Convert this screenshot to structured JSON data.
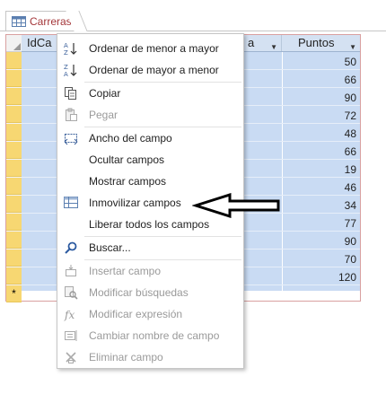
{
  "tab": {
    "label": "Carreras"
  },
  "headers": {
    "col1": "IdCa",
    "col2": "a",
    "col3": "Puntos"
  },
  "values": [
    "50",
    "66",
    "90",
    "72",
    "48",
    "66",
    "19",
    "46",
    "34",
    "77",
    "90",
    "70",
    "120"
  ],
  "new_row_marker": "*",
  "menu": {
    "sort_asc": "Ordenar de menor a mayor",
    "sort_desc": "Ordenar de mayor a menor",
    "copy": "Copiar",
    "paste": "Pegar",
    "field_width": "Ancho del campo",
    "hide_fields": "Ocultar campos",
    "show_fields": "Mostrar campos",
    "freeze_fields": "Inmovilizar campos",
    "unfreeze_all": "Liberar todos los campos",
    "find": "Buscar...",
    "insert_field": "Insertar campo",
    "modify_lookups": "Modificar búsquedas",
    "modify_expression": "Modificar expresión",
    "rename_field": "Cambiar nombre de campo",
    "delete_field": "Eliminar campo"
  },
  "icons": {
    "tab": "table-icon",
    "sort_asc": "sort-ascending-icon",
    "sort_desc": "sort-descending-icon",
    "copy": "copy-icon",
    "paste": "paste-icon",
    "field_width": "field-width-icon",
    "freeze": "freeze-columns-icon",
    "find": "search-icon",
    "insert": "insert-field-icon",
    "lookups": "lookup-icon",
    "expression": "fx-icon",
    "rename": "rename-field-icon",
    "delete": "delete-field-icon"
  },
  "colors": {
    "accent": "#a4373a",
    "row_selector": "#f7d772",
    "selection": "#c9dbf3"
  }
}
